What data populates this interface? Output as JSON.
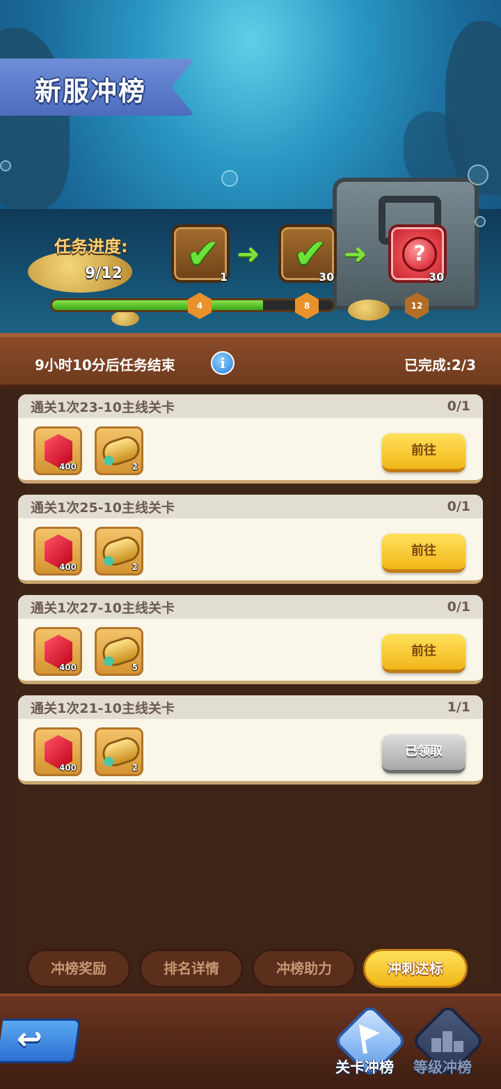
{
  "header": {
    "title": "新服冲榜"
  },
  "progress": {
    "label": "任务进度:",
    "count": "9/12",
    "current": 9,
    "total": 12,
    "milestones": [
      {
        "reward": "1",
        "threshold": "4",
        "state": "claimed",
        "icon": "check-icon"
      },
      {
        "reward": "30",
        "threshold": "8",
        "state": "claimed",
        "icon": "check-icon"
      },
      {
        "reward": "30",
        "threshold": "12",
        "state": "locked",
        "icon": "mystery-icon"
      }
    ],
    "mystery_mark": "?",
    "check_mark": "✔",
    "arrow_mark": "➜"
  },
  "status_bar": {
    "timer": "9小时10分后任务结束",
    "info_mark": "i",
    "completed": "已完成:2/3"
  },
  "tasks": [
    {
      "title": "通关1次23-10主线关卡",
      "progress": "0/1",
      "rewards": [
        {
          "icon": "gem-icon",
          "qty": "400"
        },
        {
          "icon": "scroll-icon",
          "qty": "2"
        }
      ],
      "button": "前往",
      "claimed": false
    },
    {
      "title": "通关1次25-10主线关卡",
      "progress": "0/1",
      "rewards": [
        {
          "icon": "gem-icon",
          "qty": "400"
        },
        {
          "icon": "scroll-icon",
          "qty": "2"
        }
      ],
      "button": "前往",
      "claimed": false
    },
    {
      "title": "通关1次27-10主线关卡",
      "progress": "0/1",
      "rewards": [
        {
          "icon": "gem-icon",
          "qty": "400"
        },
        {
          "icon": "scroll-icon",
          "qty": "5"
        }
      ],
      "button": "前往",
      "claimed": false
    },
    {
      "title": "通关1次21-10主线关卡",
      "progress": "1/1",
      "rewards": [
        {
          "icon": "gem-icon",
          "qty": "400"
        },
        {
          "icon": "scroll-icon",
          "qty": "2"
        }
      ],
      "button": "已领取",
      "claimed": true
    }
  ],
  "tabs": [
    {
      "label": "冲榜奖励",
      "active": false
    },
    {
      "label": "排名详情",
      "active": false
    },
    {
      "label": "冲榜助力",
      "active": false
    },
    {
      "label": "冲刺达标",
      "active": true
    }
  ],
  "bottom_nav": {
    "back_mark": "↩",
    "items": [
      {
        "label": "关卡冲榜",
        "active": true,
        "icon": "flag-icon"
      },
      {
        "label": "等级冲榜",
        "active": false,
        "icon": "podium-icon"
      }
    ]
  },
  "colors": {
    "accent_yellow": "#f2b619",
    "progress_green": "#3aa718",
    "wood": "#6f3a1e",
    "ribbon_blue": "#4d6cbd"
  }
}
